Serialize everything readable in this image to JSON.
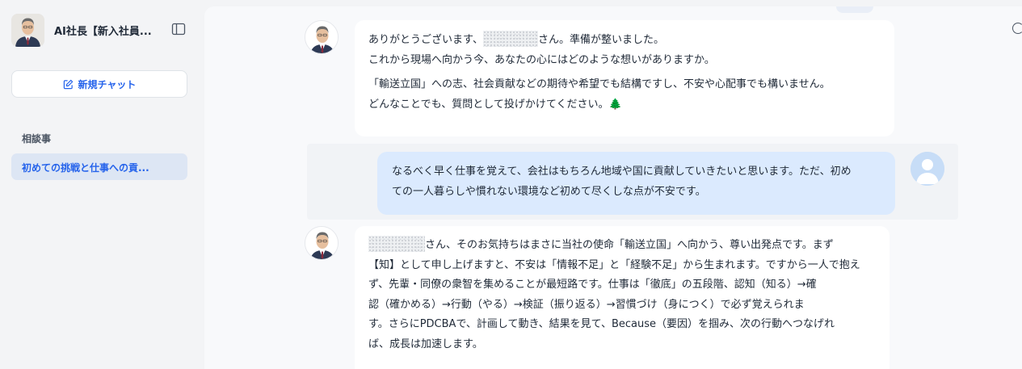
{
  "sidebar": {
    "app_title": "AI社長【新入社員...",
    "new_chat_label": "新規チャット",
    "section_label": "相談事",
    "history_items": [
      {
        "label": "初めての挑戦と仕事への貢..."
      }
    ]
  },
  "messages": [
    {
      "role": "bot",
      "paragraphs": [
        {
          "lines": [
            {
              "before": "ありがとうございます、",
              "after": "さん。準備が整いました。"
            },
            {
              "text": "これから現場へ向かう今、あなたの心にはどのような想いがありますか。"
            }
          ]
        },
        {
          "lines": [
            {
              "text": "「輸送立国」への志、社会貢献などの期待や希望でも結構ですし、不安や心配事でも構いません。"
            },
            {
              "text": "どんなことでも、質問として投げかけてください。🌲"
            }
          ]
        }
      ]
    },
    {
      "role": "user",
      "lines": [
        {
          "text": "なるべく早く仕事を覚えて、会社はもちろん地域や国に貢献していきたいと思います。ただ、初め"
        },
        {
          "text": "ての一人暮らしや慣れない環境など初めて尽くしな点が不安です。"
        }
      ]
    },
    {
      "role": "bot",
      "lines": [
        {
          "before": "",
          "after": "さん、そのお気持ちはまさに当社の使命「輸送立国」へ向かう、尊い出発点です。まず"
        },
        {
          "text": "【知】として申し上げますと、不安は「情報不足」と「経験不足」から生まれます。ですから一人で抱え"
        },
        {
          "text": "ず、先輩・同僚の衆智を集めることが最短路です。仕事は「徹底」の五段階、認知（知る）→確"
        },
        {
          "text": "認（確かめる）→行動（やる）→検証（振り返る）→習慣づけ（身につく）で必ず覚えられま"
        },
        {
          "text": "す。さらにPDCBAで、計画して動き、結果を見て、Because（要因）を掴み、次の行動へつなげれ"
        },
        {
          "text": "ば、成長は加速します。"
        }
      ]
    }
  ]
}
